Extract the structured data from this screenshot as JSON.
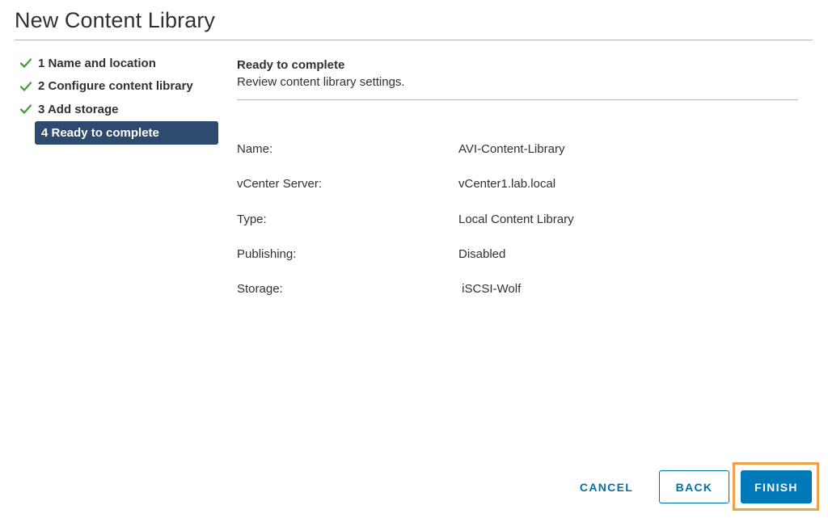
{
  "dialog": {
    "title": "New Content Library"
  },
  "steps": [
    {
      "number": "1",
      "label": "1 Name and location",
      "completed": true
    },
    {
      "number": "2",
      "label": "2 Configure content library",
      "completed": true
    },
    {
      "number": "3",
      "label": "3 Add storage",
      "completed": true
    },
    {
      "number": "4",
      "label": "4 Ready to complete",
      "active": true
    }
  ],
  "content": {
    "section_title": "Ready to complete",
    "section_desc": "Review content library settings.",
    "fields": [
      {
        "label": "Name:",
        "value": "AVI-Content-Library"
      },
      {
        "label": "vCenter Server:",
        "value": "vCenter1.lab.local"
      },
      {
        "label": "Type:",
        "value": "Local Content Library"
      },
      {
        "label": "Publishing:",
        "value": "Disabled"
      },
      {
        "label": "Storage:",
        "value": " iSCSI-Wolf"
      }
    ]
  },
  "footer": {
    "cancel_label": "CANCEL",
    "back_label": "BACK",
    "finish_label": "FINISH"
  },
  "colors": {
    "check": "#4c9e3f",
    "active_step_bg": "#2e4a6f",
    "primary": "#0079b8",
    "link": "#0072a3",
    "highlight": "#f0a04b"
  },
  "icons": {
    "step_complete": "checkmark-icon"
  }
}
